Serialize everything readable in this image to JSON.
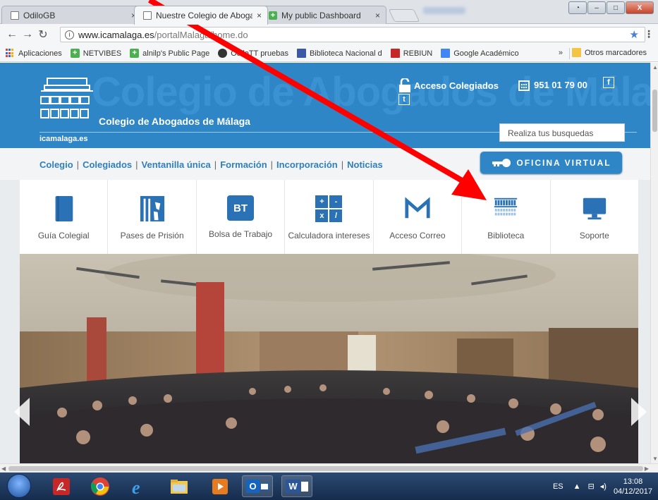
{
  "browser": {
    "tabs": [
      {
        "label": "OdiloGB",
        "active": false
      },
      {
        "label": "Nuestre Colegio de Aboga",
        "active": true
      },
      {
        "label": "My public Dashboard",
        "active": false
      }
    ],
    "tab_close": "×",
    "window_buttons": {
      "minimize": "–",
      "maximize": "□",
      "close": "X"
    },
    "url_host": "www.icamalaga.es",
    "url_path": "/portalMalaga/home.do",
    "bookmarks": [
      {
        "label": "Aplicaciones",
        "icon": "apps-icon"
      },
      {
        "label": "NETVIBES",
        "icon": "plus-icon"
      },
      {
        "label": "alnilp's Public Page",
        "icon": "plus-icon"
      },
      {
        "label": "OdiloTT pruebas",
        "icon": "odilo-icon"
      },
      {
        "label": "Biblioteca Nacional d",
        "icon": "bne-icon"
      },
      {
        "label": "REBIUN",
        "icon": "rebiun-icon"
      },
      {
        "label": "Google Académico",
        "icon": "scholar-icon"
      }
    ],
    "bookmarks_more": "»",
    "bookmarks_other": "Otros marcadores"
  },
  "site": {
    "bg_text": "Colegio de Abogados de Málaga",
    "title": "Colegio de Abogados de Málaga",
    "domain": "icamalaga.es",
    "acceso": "Acceso Colegiados",
    "phone": "951 01 79 00",
    "facebook": "f",
    "twitter": "t",
    "search_placeholder": "Realiza tus busquedas",
    "nav": [
      "Colegio",
      "Colegiados",
      "Ventanilla única",
      "Formación",
      "Incorporación",
      "Noticias"
    ],
    "nav_sep": "|",
    "oficina_virtual": "OFICINA VIRTUAL",
    "quicklinks": [
      {
        "label": "Guía Colegial",
        "icon": "book-icon"
      },
      {
        "label": "Pases de Prisión",
        "icon": "prison-icon"
      },
      {
        "label": "Bolsa de Trabajo",
        "icon": "bt-icon"
      },
      {
        "label": "Calculadora intereses",
        "icon": "calculator-icon"
      },
      {
        "label": "Acceso Correo",
        "icon": "mail-icon"
      },
      {
        "label": "Biblioteca",
        "icon": "library-icon"
      },
      {
        "label": "Soporte",
        "icon": "monitor-icon"
      }
    ],
    "bt_text": "BT",
    "calc_symbols": [
      "+",
      "-",
      "x",
      "/"
    ]
  },
  "taskbar": {
    "language": "ES",
    "time": "13:08",
    "date": "04/12/2017",
    "word_label": "W",
    "outlook_label": "O"
  },
  "colors": {
    "brand_blue": "#2f86c7",
    "nav_link": "#2f7fbe",
    "annotation_red": "#ff0000"
  }
}
